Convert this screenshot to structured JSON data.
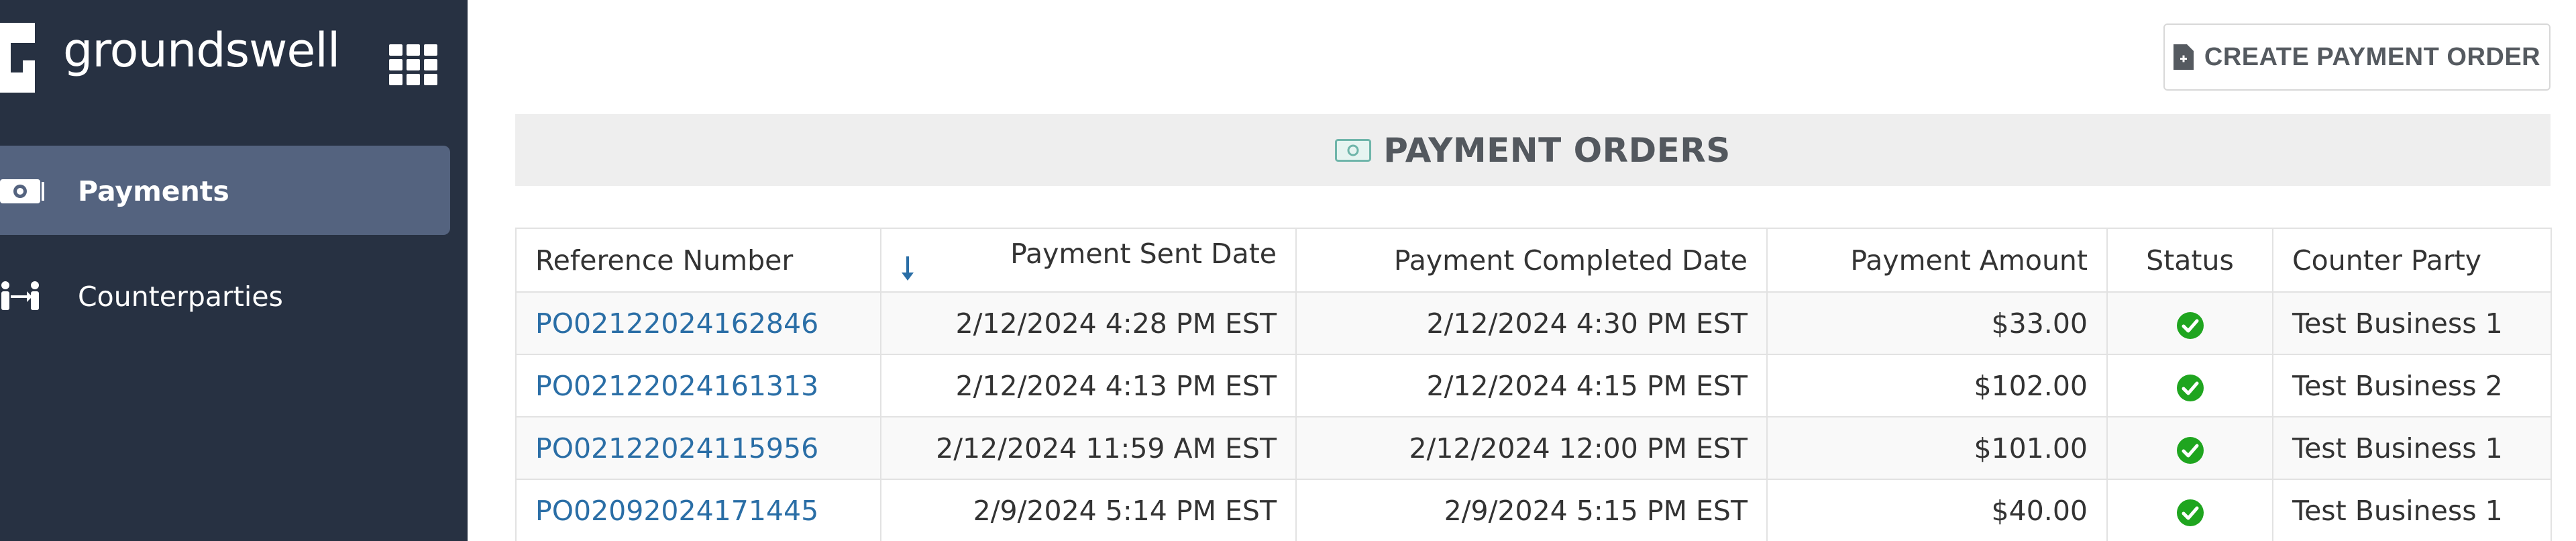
{
  "brand": {
    "name": "groundswell",
    "logo_icon": "groundswell-logo",
    "apps_icon": "grid-apps-icon"
  },
  "sidebar": {
    "items": [
      {
        "label": "Payments",
        "icon": "money-icon",
        "active": true
      },
      {
        "label": "Counterparties",
        "icon": "people-exchange-icon",
        "active": false
      }
    ]
  },
  "toolbar": {
    "create_label": "CREATE PAYMENT ORDER",
    "create_icon": "document-add-icon"
  },
  "section": {
    "title": "PAYMENT ORDERS",
    "icon": "money-icon"
  },
  "table": {
    "columns": {
      "reference": "Reference Number",
      "sent": "Payment Sent Date",
      "completed": "Payment Completed Date",
      "amount": "Payment Amount",
      "status": "Status",
      "counterparty": "Counter Party"
    },
    "sort_icon": "arrow-down-icon",
    "rows": [
      {
        "reference": "PO02122024162846",
        "sent": "2/12/2024 4:28 PM EST",
        "completed": "2/12/2024 4:30 PM EST",
        "amount": "$33.00",
        "status": "completed",
        "counterparty": "Test Business 1"
      },
      {
        "reference": "PO02122024161313",
        "sent": "2/12/2024 4:13 PM EST",
        "completed": "2/12/2024 4:15 PM EST",
        "amount": "$102.00",
        "status": "completed",
        "counterparty": "Test Business 2"
      },
      {
        "reference": "PO02122024115956",
        "sent": "2/12/2024 11:59 AM EST",
        "completed": "2/12/2024 12:00 PM EST",
        "amount": "$101.00",
        "status": "completed",
        "counterparty": "Test Business 1"
      },
      {
        "reference": "PO02092024171445",
        "sent": "2/9/2024 5:14 PM EST",
        "completed": "2/9/2024 5:15 PM EST",
        "amount": "$40.00",
        "status": "completed",
        "counterparty": "Test Business 1"
      }
    ]
  },
  "colors": {
    "sidebar_bg": "#273142",
    "nav_active_bg": "#54637f",
    "link": "#2a6ea6",
    "status_ok": "#1fa51f",
    "header_bg": "#eeeeee"
  }
}
